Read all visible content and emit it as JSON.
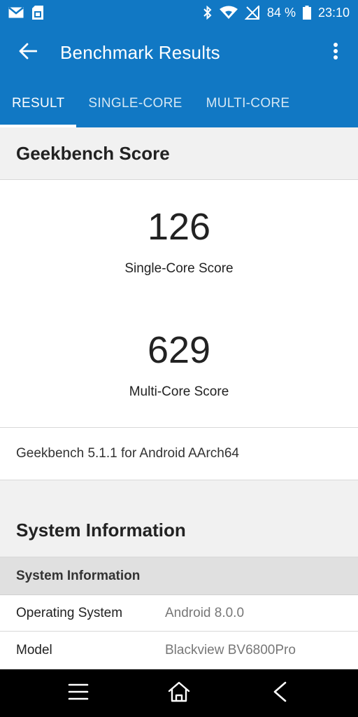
{
  "status_bar": {
    "battery": "84 %",
    "time": "23:10",
    "icons": [
      "gmail-icon",
      "sim-card-icon",
      "bluetooth-icon",
      "wifi-icon",
      "no-signal-icon",
      "battery-icon"
    ]
  },
  "app_bar": {
    "title": "Benchmark Results",
    "icons": [
      "arrow-back-icon",
      "more-vert-icon"
    ]
  },
  "tabs": [
    {
      "label": "RESULT",
      "active": true
    },
    {
      "label": "SINGLE-CORE",
      "active": false
    },
    {
      "label": "MULTI-CORE",
      "active": false
    }
  ],
  "score_section": {
    "title": "Geekbench Score",
    "single_core_score": "126",
    "single_core_label": "Single-Core Score",
    "multi_core_score": "629",
    "multi_core_label": "Multi-Core Score",
    "version": "Geekbench 5.1.1 for Android AArch64"
  },
  "system_information": {
    "title": "System Information",
    "subheader": "System Information",
    "rows": [
      {
        "key": "Operating System",
        "value": "Android 8.0.0"
      },
      {
        "key": "Model",
        "value": "Blackview BV6800Pro"
      }
    ]
  },
  "nav_bar": {
    "icons": [
      "menu-icon",
      "home-icon",
      "back-icon"
    ]
  },
  "colors": {
    "primary": "#1178c4",
    "background": "#f1f1f1",
    "subheader": "#e0e0e0"
  }
}
